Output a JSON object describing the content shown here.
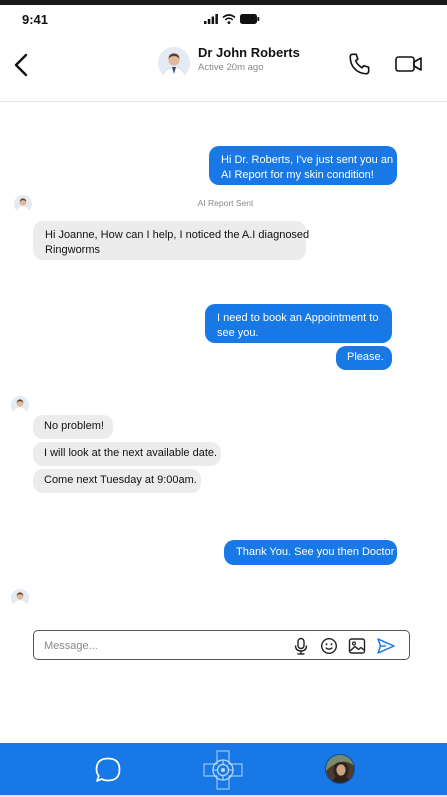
{
  "status_bar": {
    "time": "9:41"
  },
  "header": {
    "name": "Dr John Roberts",
    "status": "Active 20m ago"
  },
  "messages": {
    "m1_line1": "Hi Dr. Roberts, I've just sent you an",
    "m1_line2": "AI Report for my skin condition!",
    "system_note": "AI Report Sent",
    "m2_line1": "Hi Joanne, How can I help, I noticed the A.I diagnosed",
    "m2_line2": "Ringworms",
    "m3_line1": "I need to book an Appointment to",
    "m3_line2": "see you.",
    "m4": "Please.",
    "m5": "No problem!",
    "m6": "I will look at the next available date.",
    "m7": "Come next Tuesday at 9:00am.",
    "m8": "Thank You. See you then Doctor"
  },
  "composer": {
    "placeholder": "Message..."
  },
  "icons": {
    "back": "chevron-left-icon",
    "call": "phone-icon",
    "video": "video-camera-icon",
    "mic": "microphone-icon",
    "emoji": "smiley-icon",
    "image": "image-icon",
    "send": "send-icon",
    "chat": "chat-bubble-icon",
    "logo": "app-logo-icon"
  },
  "colors": {
    "accent": "#1778e6",
    "incoming_bubble": "#ececec",
    "outgoing_text": "#ffffff"
  }
}
